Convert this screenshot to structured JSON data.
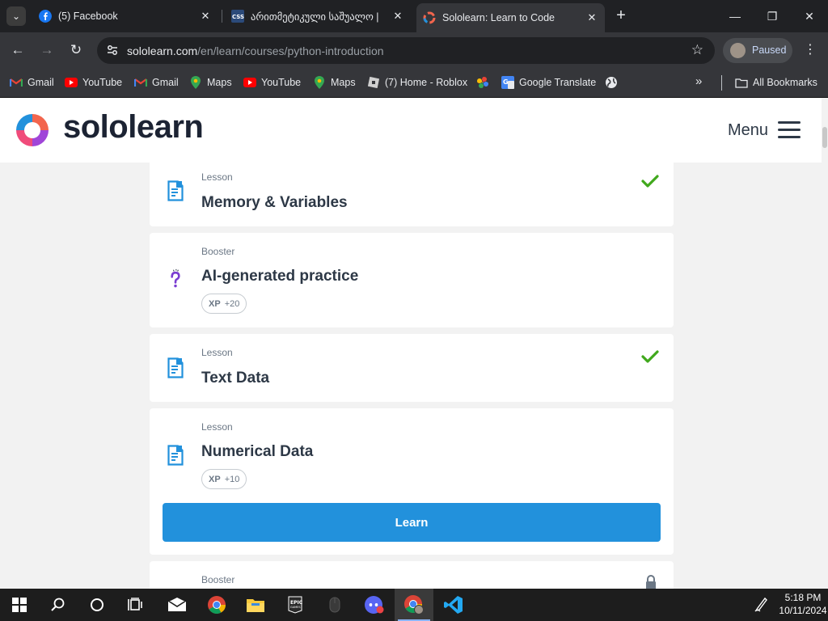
{
  "browser": {
    "tabs": [
      {
        "label": "(5) Facebook",
        "favicon": "facebook-icon",
        "active": false
      },
      {
        "label": "არითმეტიკული საშუალო |",
        "favicon": "css-icon",
        "active": false
      },
      {
        "label": "Sololearn: Learn to Code",
        "favicon": "sololearn-icon",
        "active": true
      }
    ],
    "url_host": "sololearn.com",
    "url_path": "/en/learn/courses/python-introduction",
    "profile_label": "Paused",
    "bookmarks": [
      {
        "label": "Gmail",
        "icon": "gmail-icon"
      },
      {
        "label": "YouTube",
        "icon": "youtube-icon"
      },
      {
        "label": "Gmail",
        "icon": "gmail-icon"
      },
      {
        "label": "Maps",
        "icon": "maps-icon"
      },
      {
        "label": "YouTube",
        "icon": "youtube-icon"
      },
      {
        "label": "Maps",
        "icon": "maps-icon"
      },
      {
        "label": "(7) Home - Roblox",
        "icon": "roblox-icon"
      },
      {
        "label": "",
        "icon": "photos-icon"
      },
      {
        "label": "Google Translate",
        "icon": "translate-icon"
      },
      {
        "label": "",
        "icon": "globe-icon"
      }
    ],
    "all_bookmarks_label": "All Bookmarks"
  },
  "site": {
    "logo_text": "sololearn",
    "menu_label": "Menu"
  },
  "course_items": [
    {
      "type": "Lesson",
      "title": "Memory & Variables",
      "completed": true,
      "xp": null
    },
    {
      "type": "Booster",
      "title": "AI-generated practice",
      "completed": false,
      "xp": "+20"
    },
    {
      "type": "Lesson",
      "title": "Text Data",
      "completed": true,
      "xp": null
    },
    {
      "type": "Lesson",
      "title": "Numerical Data",
      "completed": false,
      "xp": "+10",
      "action": "Learn"
    },
    {
      "type": "Booster",
      "title": "",
      "completed": false,
      "locked": true
    }
  ],
  "xp_label": "XP",
  "taskbar": {
    "time": "5:18 PM",
    "date": "10/11/2024",
    "apps": [
      "windows-start-icon",
      "search-icon",
      "cortana-icon",
      "task-view-icon",
      "mail-icon",
      "chrome-icon",
      "file-explorer-icon",
      "epic-games-icon",
      "mouse-icon",
      "discord-icon",
      "chrome-profile-icon",
      "vscode-icon"
    ]
  },
  "colors": {
    "accent": "#2291dc",
    "check": "#40a81c",
    "lesson_icon": "#2291dc",
    "booster_icon": "#7a3cd1"
  }
}
